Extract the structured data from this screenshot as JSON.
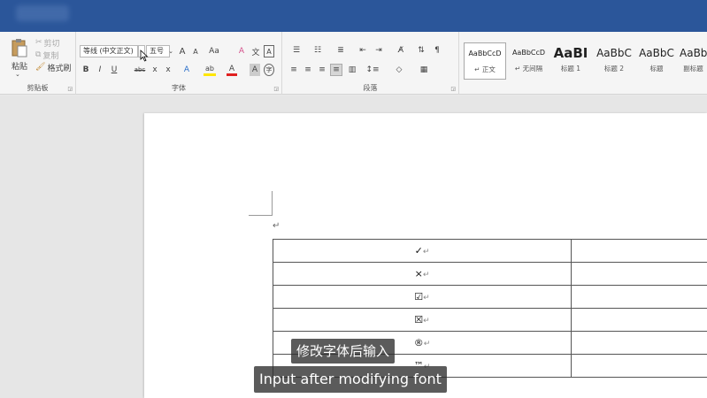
{
  "ribbon": {
    "clipboard": {
      "label": "剪贴板",
      "paste": "粘贴",
      "cut": "剪切",
      "copy": "复制",
      "format_painter": "格式刷"
    },
    "font": {
      "label": "字体",
      "font_name": "等线 (中文正文)",
      "font_size": "五号",
      "grow": "A",
      "shrink": "A",
      "change_case": "Aa",
      "clear_format": "A",
      "phonetic": "文",
      "char_border": "A",
      "bold": "B",
      "italic": "I",
      "underline": "U",
      "strike": "abc",
      "subscript": "x",
      "superscript": "x",
      "text_effects": "A",
      "highlight": "ab",
      "font_color": "A",
      "char_shading": "A",
      "enclose": "字"
    },
    "paragraph": {
      "label": "段落"
    },
    "styles": [
      {
        "preview": "AaBbCcD",
        "name": "↵ 正文"
      },
      {
        "preview": "AaBbCcD",
        "name": "↵ 无间隔"
      },
      {
        "preview": "AaBI",
        "name": "标题 1"
      },
      {
        "preview": "AaBbC",
        "name": "标题 2"
      },
      {
        "preview": "AaBbC",
        "name": "标题"
      },
      {
        "preview": "AaBb",
        "name": "副标题"
      }
    ]
  },
  "document": {
    "paragraph_mark": "↵",
    "table_rows": [
      {
        "symbol": "✓",
        "mark": "↵"
      },
      {
        "symbol": "×",
        "mark": "↵"
      },
      {
        "symbol": "☑",
        "mark": "↵"
      },
      {
        "symbol": "☒",
        "mark": "↵"
      },
      {
        "symbol": "®",
        "mark": "↵"
      },
      {
        "symbol": "™",
        "mark": "↵"
      }
    ]
  },
  "subtitles": {
    "chinese": "修改字体后输入",
    "english": "Input after modifying font"
  },
  "colors": {
    "titlebar": "#2b569a",
    "highlight": "#ffe600",
    "font_color": "#e02020"
  }
}
